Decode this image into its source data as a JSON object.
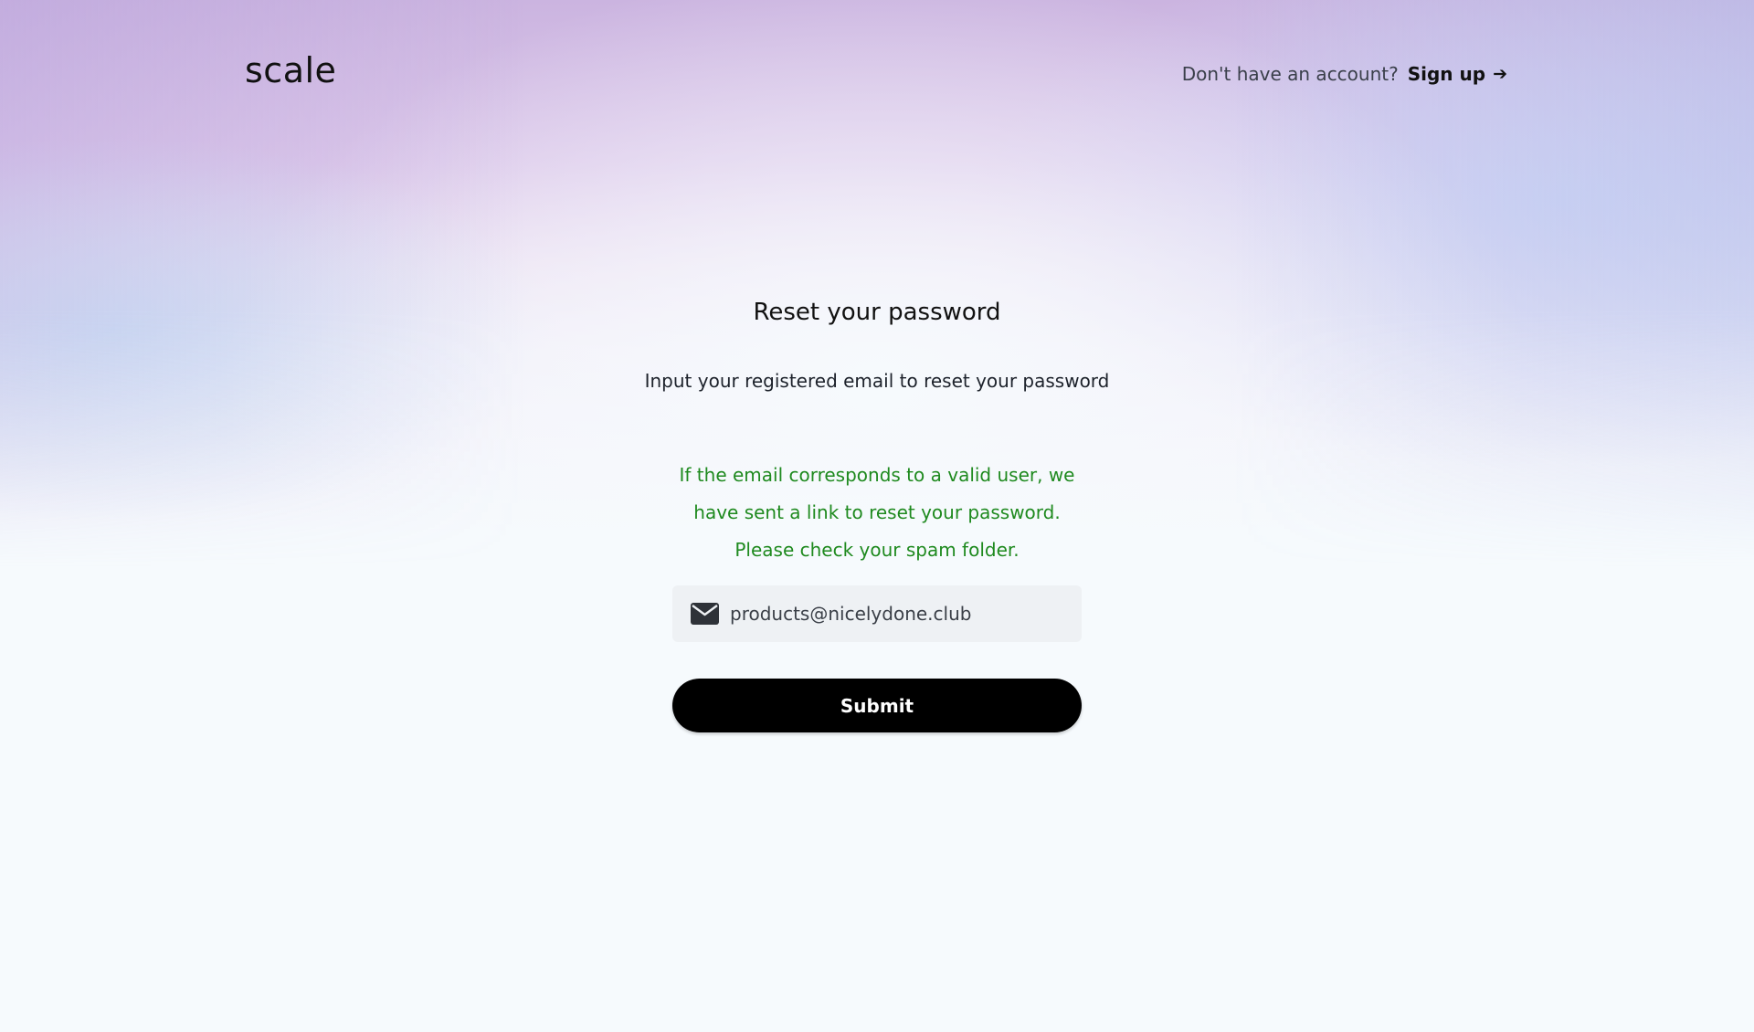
{
  "header": {
    "logo_text": "scale",
    "account_prompt": "Don't have an account?",
    "signup_label": "Sign up",
    "signup_arrow": "➔"
  },
  "form": {
    "title": "Reset your password",
    "subtitle": "Input your registered email to reset your password",
    "success_lines": [
      "If the email corresponds to a valid user, we",
      "have sent a link to reset your password.",
      "Please check your spam folder."
    ],
    "email_value": "products@nicelydone.club",
    "email_icon": "envelope-icon",
    "submit_label": "Submit"
  },
  "colors": {
    "success_text": "#1f8a1f",
    "button_bg": "#000000",
    "input_bg": "#eef1f4"
  }
}
